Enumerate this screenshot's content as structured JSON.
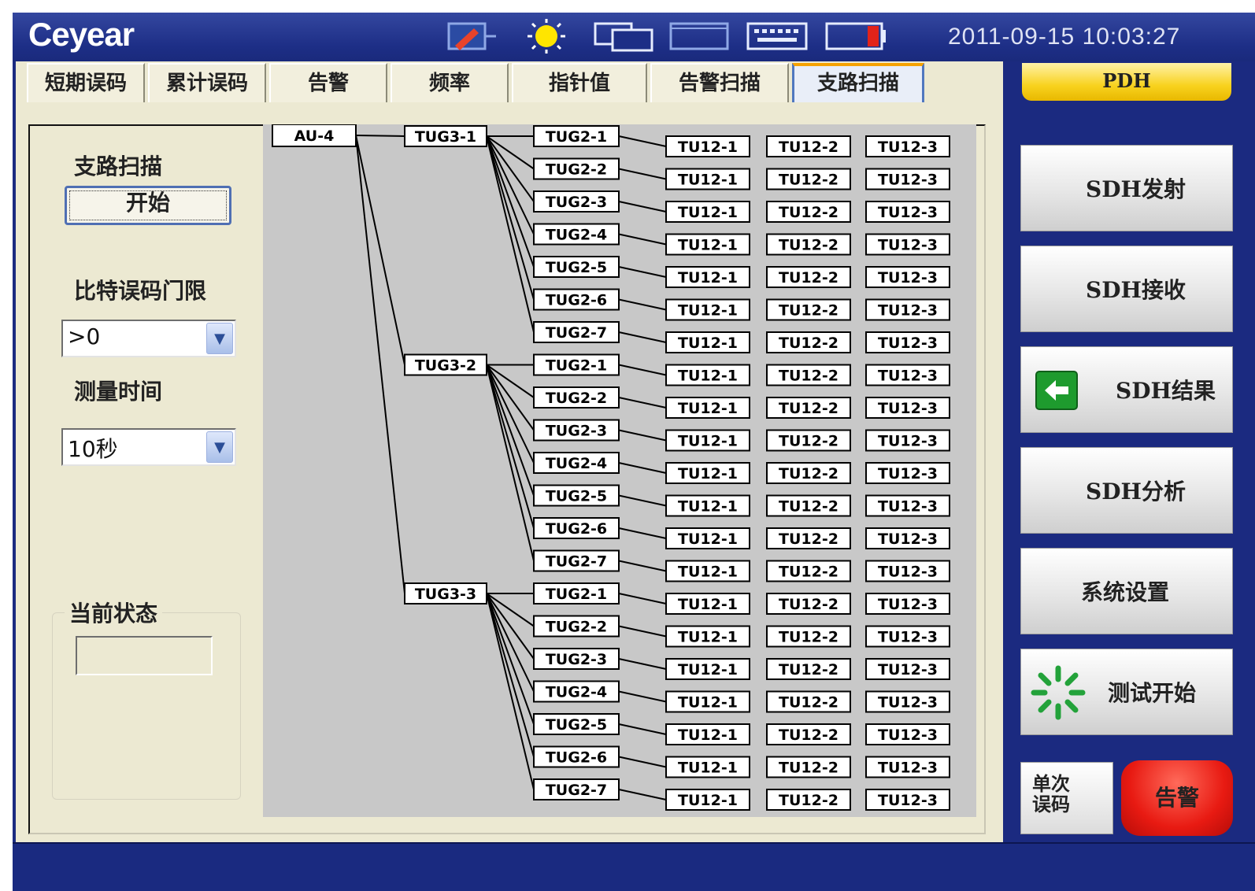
{
  "app": {
    "logo": "Ceyear",
    "datetime": "2011-09-15 10:03:27",
    "title_icons": [
      "edit-icon",
      "sun-icon",
      "windows-icon",
      "window-icon",
      "keyboard-icon",
      "battery-icon"
    ]
  },
  "tabs": [
    {
      "label": "短期误码",
      "active": false
    },
    {
      "label": "累计误码",
      "active": false
    },
    {
      "label": "告警",
      "active": false
    },
    {
      "label": "频率",
      "active": false
    },
    {
      "label": "指针值",
      "active": false
    },
    {
      "label": "告警扫描",
      "active": false
    },
    {
      "label": "支路扫描",
      "active": true
    }
  ],
  "left_panel": {
    "section_title": "支路扫描",
    "start_button": "开始",
    "threshold_label": "比特误码门限",
    "threshold_value": ">0",
    "duration_label": "测量时间",
    "duration_value": "10秒",
    "status_label": "当前状态",
    "status_value": ""
  },
  "tree": {
    "au": "AU-4",
    "tug3": [
      {
        "label": "TUG3-1",
        "tug2": [
          "TUG2-1",
          "TUG2-2",
          "TUG2-3",
          "TUG2-4",
          "TUG2-5",
          "TUG2-6",
          "TUG2-7"
        ]
      },
      {
        "label": "TUG3-2",
        "tug2": [
          "TUG2-1",
          "TUG2-2",
          "TUG2-3",
          "TUG2-4",
          "TUG2-5",
          "TUG2-6",
          "TUG2-7"
        ]
      },
      {
        "label": "TUG3-3",
        "tug2": [
          "TUG2-1",
          "TUG2-2",
          "TUG2-3",
          "TUG2-4",
          "TUG2-5",
          "TUG2-6",
          "TUG2-7"
        ]
      }
    ],
    "tu12": [
      "TU12-1",
      "TU12-2",
      "TU12-3"
    ]
  },
  "sidebar": {
    "pdh": "PDH",
    "buttons": [
      {
        "label": "SDH发射",
        "icon": null
      },
      {
        "label": "SDH接收",
        "icon": null
      },
      {
        "label": "SDH结果",
        "icon": "back-arrow-icon"
      },
      {
        "label": "SDH分析",
        "icon": null
      },
      {
        "label": "系统设置",
        "icon": null
      },
      {
        "label": "测试开始",
        "icon": "spinner-icon"
      }
    ],
    "single_error": "单次误码",
    "alarm": "告警"
  },
  "colors": {
    "frame": "#1b2a80",
    "panel": "#ece9d2",
    "active_tab_accent": "#f6a200",
    "pdh": "#f8d21e",
    "alarm": "#e81a12",
    "tree_bg": "#c8c8c8"
  }
}
